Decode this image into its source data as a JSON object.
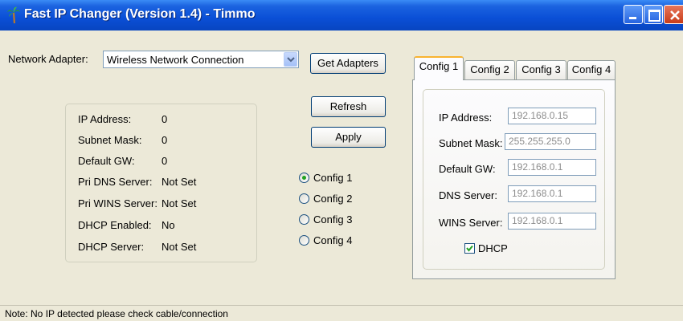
{
  "window": {
    "title": "Fast IP Changer (Version 1.4) - Timmo"
  },
  "adapter": {
    "label": "Network Adapter:",
    "selected": "Wireless Network Connection",
    "get_adapters_label": "Get Adapters"
  },
  "actions": {
    "refresh_label": "Refresh",
    "apply_label": "Apply"
  },
  "current_info": [
    {
      "label": "IP Address:",
      "value": "0"
    },
    {
      "label": "Subnet Mask:",
      "value": "0"
    },
    {
      "label": "Default GW:",
      "value": "0"
    },
    {
      "label": "Pri DNS Server:",
      "value": "Not Set"
    },
    {
      "label": "Pri WINS Server:",
      "value": "Not Set"
    },
    {
      "label": "DHCP Enabled:",
      "value": "No"
    },
    {
      "label": "DHCP Server:",
      "value": "Not Set"
    }
  ],
  "config_radios": [
    {
      "label": "Config 1",
      "checked": true
    },
    {
      "label": "Config 2",
      "checked": false
    },
    {
      "label": "Config 3",
      "checked": false
    },
    {
      "label": "Config 4",
      "checked": false
    }
  ],
  "tabs": [
    {
      "label": "Config 1",
      "active": true
    },
    {
      "label": "Config 2",
      "active": false
    },
    {
      "label": "Config 3",
      "active": false
    },
    {
      "label": "Config 4",
      "active": false
    }
  ],
  "config_form": {
    "ip_label": "IP Address:",
    "ip_placeholder": "192.168.0.15",
    "mask_label": "Subnet Mask:",
    "mask_placeholder": "255.255.255.0",
    "gw_label": "Default GW:",
    "gw_placeholder": "192.168.0.1",
    "dns_label": "DNS Server:",
    "dns_placeholder": "192.168.0.1",
    "wins_label": "WINS Server:",
    "wins_placeholder": "192.168.0.1",
    "dhcp_label": "DHCP",
    "dhcp_checked": true
  },
  "status": {
    "text": "Note: No IP detected please check cable/connection"
  }
}
